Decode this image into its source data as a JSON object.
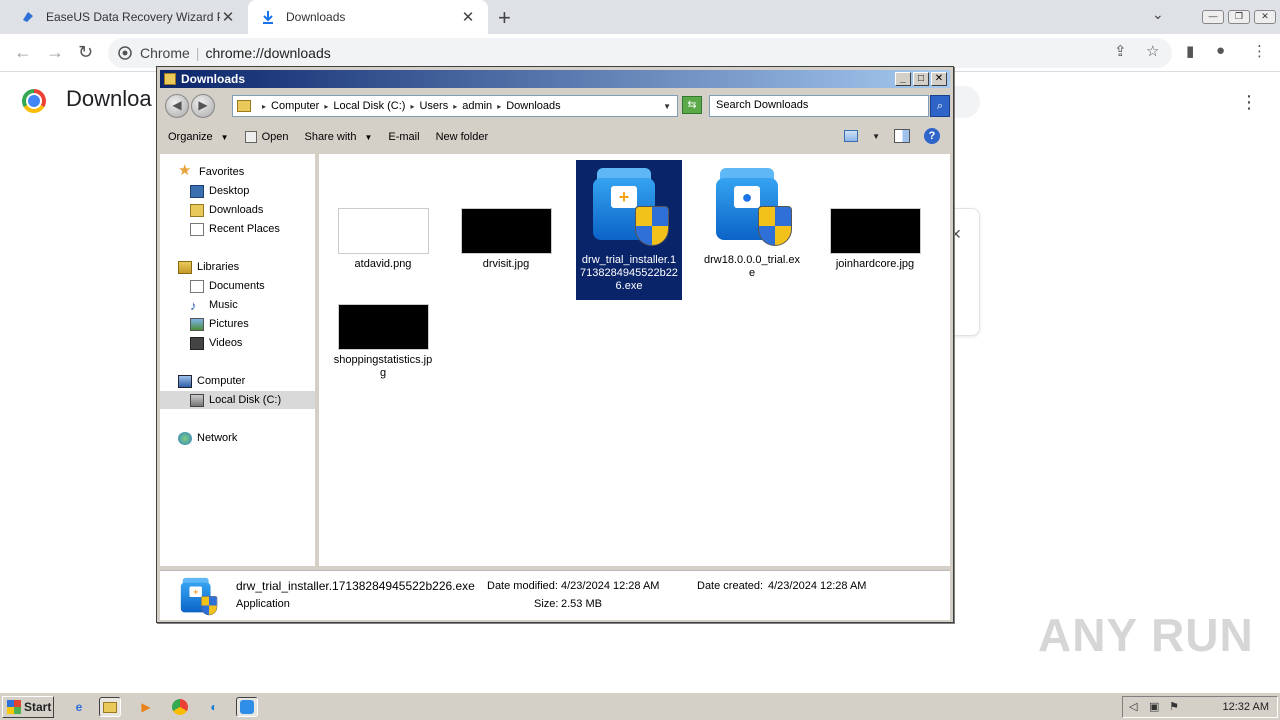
{
  "browser": {
    "tabs": [
      {
        "title": "EaseUS Data Recovery Wizard Profe",
        "active": false
      },
      {
        "title": "Downloads",
        "active": true
      }
    ],
    "new_tab_glyph": "+",
    "omnibox": {
      "site": "Chrome",
      "url": "chrome://downloads"
    }
  },
  "page": {
    "title": "Downloa"
  },
  "explorer": {
    "title": "Downloads",
    "breadcrumb": [
      "Computer",
      "Local Disk (C:)",
      "Users",
      "admin",
      "Downloads"
    ],
    "search_placeholder": "Search Downloads",
    "commands": {
      "organize": "Organize",
      "open": "Open",
      "share_with": "Share with",
      "email": "E-mail",
      "new_folder": "New folder"
    },
    "nav": {
      "favorites": "Favorites",
      "desktop": "Desktop",
      "downloads": "Downloads",
      "recent_places": "Recent Places",
      "libraries": "Libraries",
      "documents": "Documents",
      "music": "Music",
      "pictures": "Pictures",
      "videos": "Videos",
      "computer": "Computer",
      "local_disk": "Local Disk (C:)",
      "network": "Network"
    },
    "files": [
      {
        "name": "atdavid.png",
        "kind": "image-white"
      },
      {
        "name": "drvisit.jpg",
        "kind": "image-black"
      },
      {
        "name": "drw_trial_installer.17138284945522b226.exe",
        "kind": "exe",
        "selected": true
      },
      {
        "name": "drw18.0.0.0_trial.exe",
        "kind": "exe"
      },
      {
        "name": "joinhardcore.jpg",
        "kind": "image-black"
      },
      {
        "name": "shoppingstatistics.jpg",
        "kind": "image-black"
      }
    ],
    "details": {
      "filename": "drw_trial_installer.17138284945522b226.exe",
      "type": "Application",
      "modified_label": "Date modified:",
      "modified_value": "4/23/2024 12:28 AM",
      "size_label": "Size:",
      "size_value": "2.53 MB",
      "created_label": "Date created:",
      "created_value": "4/23/2024 12:28 AM"
    }
  },
  "taskbar": {
    "start_label": "Start",
    "clock": "12:32 AM"
  },
  "watermark": "ANY RUN"
}
